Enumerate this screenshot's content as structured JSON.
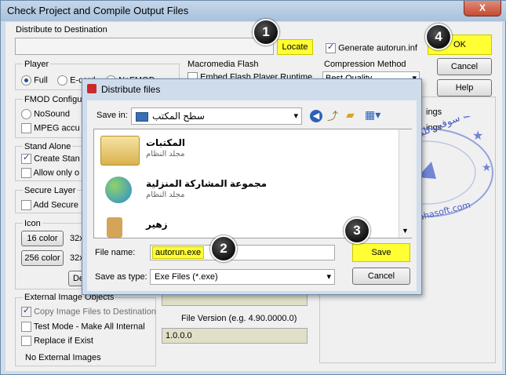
{
  "outer": {
    "title": "Check Project and Compile Output Files",
    "close": "X",
    "distribute_label": "Distribute to Destination",
    "locate": "Locate",
    "generate_autorun": "Generate autorun.inf",
    "ok": "OK",
    "cancel": "Cancel",
    "help": "Help",
    "player_label": "Player",
    "player_full": "Full",
    "player_ecard": "E-card",
    "player_nofmod": "NoFMOD",
    "macromedia_label": "Macromedia Flash",
    "embed_flash": "Embed Flash Player Runtime",
    "compression_label": "Compression Method",
    "compression_value": "Best Quality",
    "fmod_label": "FMOD Configura",
    "nosound": "NoSound",
    "mpeg": "MPEG accu",
    "standalone_label": "Stand Alone",
    "create_stand": "Create Stan",
    "allow_only": "Allow only o",
    "secure_label": "Secure Layer",
    "add_secure": "Add Secure",
    "icon_label": "Icon",
    "color16": "16 color",
    "color256": "256 color",
    "size32a": "32x",
    "size32b": "32x",
    "de_button": "De",
    "ings1": "ings",
    "ings2": "ings",
    "external_label": "External Image Objects",
    "copy_image": "Copy Image Files to Destination",
    "test_mode": "Test Mode - Make All Internal",
    "replace_exist": "Replace if Exist",
    "no_external": "No External Images",
    "file_version_label": "File Version (e.g. 4.90.0000.0)",
    "file_version_value": "1.0.0.0"
  },
  "dialog": {
    "title": "Distribute files",
    "save_in_label": "Save in:",
    "save_in_value": "سطح المكتب",
    "items": [
      {
        "title": "المكتبات",
        "sub": "مجلد النظام"
      },
      {
        "title": "مجموعة المشاركة المنزلية",
        "sub": "مجلد النظام"
      },
      {
        "title": "زهير"
      }
    ],
    "file_name_label": "File name:",
    "file_name_value": "autorun.exe",
    "save_as_type_label": "Save as type:",
    "save_as_type_value": "Exe Files (*.exe)",
    "save": "Save",
    "cancel": "Cancel"
  },
  "badges": [
    "1",
    "2",
    "3",
    "4"
  ],
  "watermark": {
    "arabic": "طه سوفت للبرامج",
    "url": "www.tahasoft.com"
  },
  "colors": {
    "highlight": "#ffff33",
    "accent_blue": "#1b4f98"
  }
}
